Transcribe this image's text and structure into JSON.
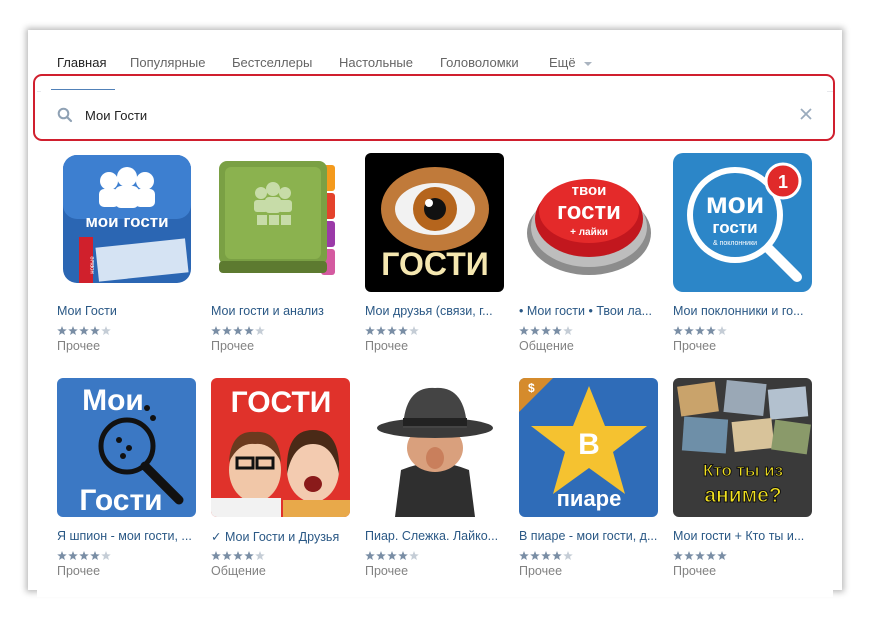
{
  "tabs": [
    {
      "label": "Главная",
      "active": true
    },
    {
      "label": "Популярные",
      "active": false
    },
    {
      "label": "Бестселлеры",
      "active": false
    },
    {
      "label": "Настольные",
      "active": false
    },
    {
      "label": "Головоломки",
      "active": false
    },
    {
      "label": "Ещё",
      "active": false
    }
  ],
  "search": {
    "value": "Мои Гости"
  },
  "colors": {
    "accent": "#5181b8",
    "highlight": "#d01f2e",
    "link": "#2a5885",
    "muted": "#828282",
    "star_on": "#7a8ea5",
    "star_off": "#c5cdd6"
  },
  "apps": [
    {
      "title": "Мои Гости",
      "category": "Прочее",
      "rating": 4,
      "icon_text": [
        "мои гости"
      ],
      "icon_badge": "новые"
    },
    {
      "title": "Мои гости и анализ",
      "category": "Прочее",
      "rating": 4,
      "icon_text": []
    },
    {
      "title": "Мои друзья (связи, г...",
      "category": "Прочее",
      "rating": 4,
      "icon_text": [
        "ГОСТИ"
      ]
    },
    {
      "title": "• Мои гости • Твои ла...",
      "category": "Общение",
      "rating": 4,
      "icon_text": [
        "твои",
        "гости",
        "+ лайки"
      ]
    },
    {
      "title": "Мои поклонники и го...",
      "category": "Прочее",
      "rating": 4,
      "icon_text": [
        "мои",
        "гости",
        "& поклонники"
      ],
      "icon_badge": "1"
    },
    {
      "title": "Я шпион - мои гости, ...",
      "category": "Прочее",
      "rating": 4,
      "icon_text": [
        "Мои",
        "Гости"
      ]
    },
    {
      "title": "✓ Мои Гости и Друзья",
      "category": "Общение",
      "rating": 4,
      "icon_text": [
        "ГОСТИ"
      ]
    },
    {
      "title": "Пиар. Слежка. Лайко...",
      "category": "Прочее",
      "rating": 4,
      "icon_text": []
    },
    {
      "title": "В пиаре - мои гости, д...",
      "category": "Прочее",
      "rating": 4,
      "icon_text": [
        "В",
        "пиаре",
        "$"
      ]
    },
    {
      "title": "Мои гости + Кто ты и...",
      "category": "Прочее",
      "rating": 5,
      "icon_text": [
        "Кто ты из",
        "аниме?"
      ]
    }
  ]
}
